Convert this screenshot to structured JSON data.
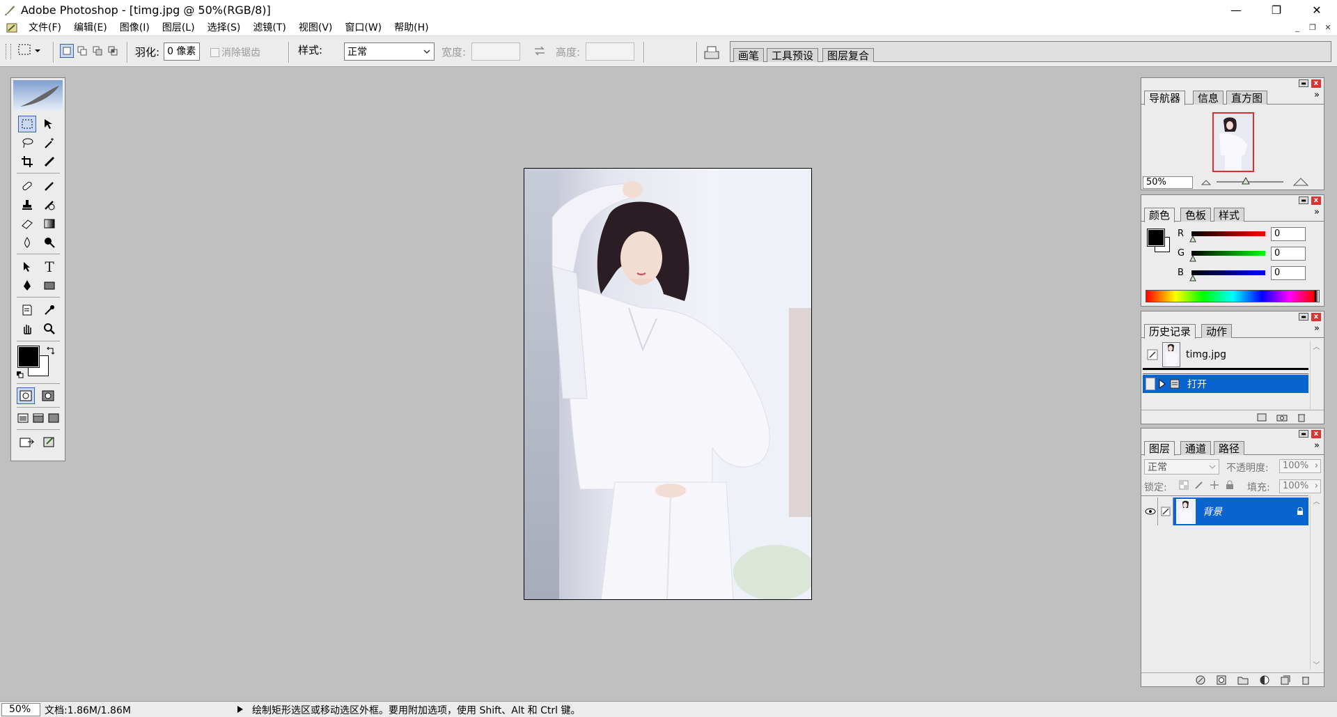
{
  "window": {
    "title": "Adobe Photoshop - [timg.jpg @ 50%(RGB/8)]",
    "minimize": "—",
    "restore": "❐",
    "close": "✕"
  },
  "menu": {
    "items": [
      "文件(F)",
      "编辑(E)",
      "图像(I)",
      "图层(L)",
      "选择(S)",
      "滤镜(T)",
      "视图(V)",
      "窗口(W)",
      "帮助(H)"
    ],
    "doc_min": "_",
    "doc_restore": "❐",
    "doc_close": "✕"
  },
  "options": {
    "feather_label": "羽化:",
    "feather_value": "0 像素",
    "antialias_label": "消除锯齿",
    "style_label": "样式:",
    "style_value": "正常",
    "width_label": "宽度:",
    "height_label": "高度:",
    "well_tabs": [
      "画笔",
      "工具预设",
      "图层复合"
    ]
  },
  "navigator": {
    "tabs": [
      "导航器",
      "信息",
      "直方图"
    ],
    "zoom": "50%"
  },
  "color": {
    "tabs": [
      "颜色",
      "色板",
      "样式"
    ],
    "channels": [
      {
        "label": "R",
        "value": "0",
        "color": "#d00000"
      },
      {
        "label": "G",
        "value": "0",
        "color": "#00a000"
      },
      {
        "label": "B",
        "value": "0",
        "color": "#0000c0"
      }
    ]
  },
  "history": {
    "tabs": [
      "历史记录",
      "动作"
    ],
    "snapshot": "timg.jpg",
    "items": [
      "打开"
    ]
  },
  "layers": {
    "tabs": [
      "图层",
      "通道",
      "路径"
    ],
    "blend_mode": "正常",
    "opacity_label": "不透明度:",
    "opacity_value": "100%",
    "lock_label": "锁定:",
    "fill_label": "填充:",
    "fill_value": "100%",
    "layer_name": "背景"
  },
  "status": {
    "zoom": "50%",
    "doc_size": "文档:1.86M/1.86M",
    "hint": "绘制矩形选区或移动选区外框。要用附加选项，使用 Shift、Alt 和 Ctrl 键。"
  },
  "accent": "#0a64d0"
}
